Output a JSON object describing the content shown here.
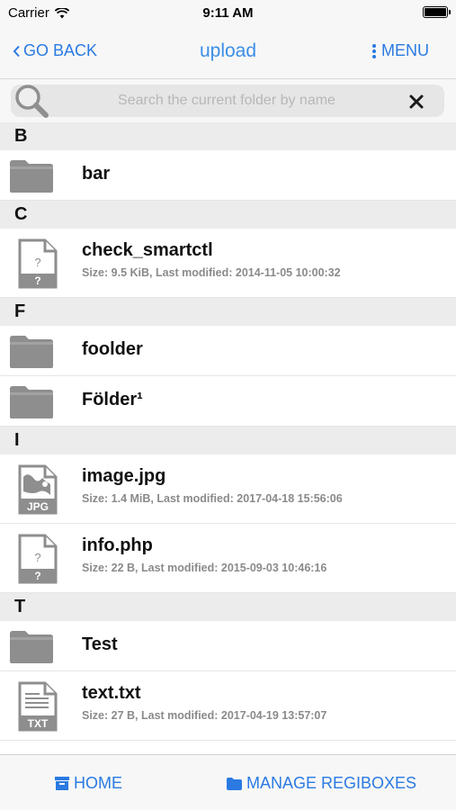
{
  "status_bar": {
    "carrier": "Carrier",
    "time": "9:11 AM",
    "icons": [
      "wifi-icon",
      "battery-icon"
    ]
  },
  "nav": {
    "back_label": "GO BACK",
    "title": "upload",
    "menu_label": "MENU",
    "accent_color": "#2a7ae2"
  },
  "search": {
    "placeholder": "Search the current folder by name",
    "value": ""
  },
  "sections": {
    "b": {
      "letter": "B",
      "items": [
        {
          "name": "bar",
          "kind": "folder",
          "icon": "folder-icon"
        }
      ]
    },
    "c": {
      "letter": "C",
      "items": [
        {
          "name": "check_smartctl",
          "kind": "file",
          "icon": "unknown-file-icon",
          "meta": "Size: 9.5 KiB, Last modified: 2014-11-05 10:00:32"
        }
      ]
    },
    "f": {
      "letter": "F",
      "items": [
        {
          "name": "foolder",
          "kind": "folder",
          "icon": "folder-icon"
        },
        {
          "name": "Földer¹",
          "kind": "folder",
          "icon": "folder-icon"
        }
      ]
    },
    "i": {
      "letter": "I",
      "items": [
        {
          "name": "image.jpg",
          "kind": "file",
          "icon": "jpg-file-icon",
          "meta": "Size: 1.4 MiB, Last modified: 2017-04-18 15:56:06"
        },
        {
          "name": "info.php",
          "kind": "file",
          "icon": "unknown-file-icon",
          "meta": "Size: 22 B, Last modified: 2015-09-03 10:46:16"
        }
      ]
    },
    "t": {
      "letter": "T",
      "items": [
        {
          "name": "Test",
          "kind": "folder",
          "icon": "folder-icon"
        },
        {
          "name": "text.txt",
          "kind": "file",
          "icon": "txt-file-icon",
          "meta": "Size: 27 B, Last modified: 2017-04-19 13:57:07"
        }
      ]
    }
  },
  "tabs": {
    "home_label": "HOME",
    "manage_label": "MANAGE REGIBOXES"
  }
}
